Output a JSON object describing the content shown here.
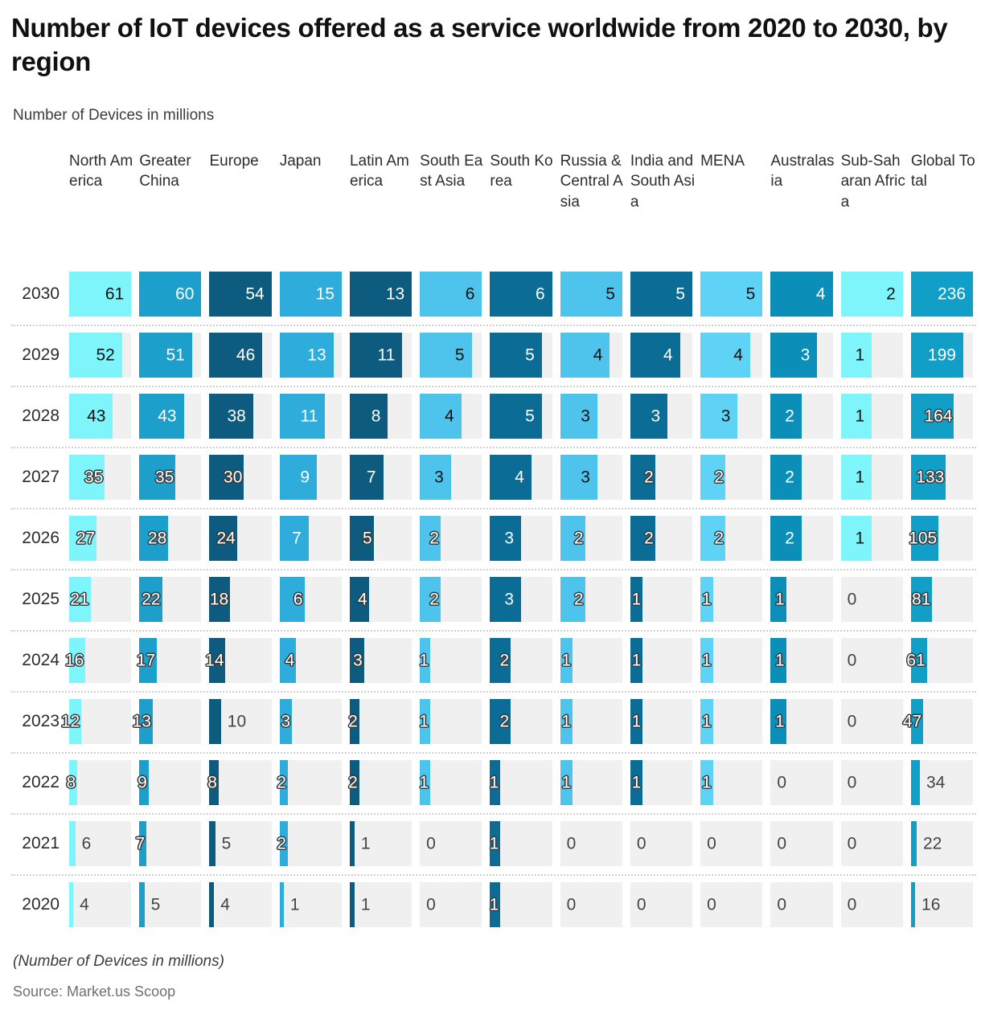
{
  "header": {
    "title": "Number of IoT devices offered as a service worldwide from 2020 to 2030, by region",
    "subtitle": "Number of Devices in millions"
  },
  "footer": {
    "note": "(Number of Devices in millions)",
    "source": "Source: Market.us Scoop"
  },
  "chart_data": {
    "type": "bar",
    "title": "Number of IoT devices offered as a service worldwide from 2020 to 2030, by region",
    "subtitle": "Number of Devices in millions",
    "xlabel": "",
    "ylabel": "Number of Devices in millions",
    "orientation": "horizontal",
    "layout": "small-multiples-grid",
    "grid": false,
    "legend": "none",
    "note": "Each column is an independent horizontal bar track scaled to that column's maximum (the 2030 row).",
    "categories": [
      "North America",
      "Greater China",
      "Europe",
      "Japan",
      "Latin America",
      "South East Asia",
      "South Korea",
      "Russia & Central Asia",
      "India and South Asia",
      "MENA",
      "Australasia",
      "Sub-Saharan Africa",
      "Global Total"
    ],
    "category_colors": [
      "#7df5fb",
      "#1d9fcb",
      "#0d5b7e",
      "#2eacdb",
      "#0d5b7e",
      "#4ec3ec",
      "#0b6d96",
      "#4ec3ec",
      "#0b6d96",
      "#5fd3f5",
      "#0b8fb8",
      "#7df5fb",
      "#129fc7"
    ],
    "rows": [
      "2030",
      "2029",
      "2028",
      "2027",
      "2026",
      "2025",
      "2024",
      "2023",
      "2022",
      "2021",
      "2020"
    ],
    "series": [
      {
        "name": "2030",
        "values": [
          61,
          60,
          54,
          15,
          13,
          6,
          6,
          5,
          5,
          5,
          4,
          2,
          236
        ]
      },
      {
        "name": "2029",
        "values": [
          52,
          51,
          46,
          13,
          11,
          5,
          5,
          4,
          4,
          4,
          3,
          1,
          199
        ]
      },
      {
        "name": "2028",
        "values": [
          43,
          43,
          38,
          11,
          8,
          4,
          5,
          3,
          3,
          3,
          2,
          1,
          164
        ]
      },
      {
        "name": "2027",
        "values": [
          35,
          35,
          30,
          9,
          7,
          3,
          4,
          3,
          2,
          2,
          2,
          1,
          133
        ]
      },
      {
        "name": "2026",
        "values": [
          27,
          28,
          24,
          7,
          5,
          2,
          3,
          2,
          2,
          2,
          2,
          1,
          105
        ]
      },
      {
        "name": "2025",
        "values": [
          21,
          22,
          18,
          6,
          4,
          2,
          3,
          2,
          1,
          1,
          1,
          0,
          81
        ]
      },
      {
        "name": "2024",
        "values": [
          16,
          17,
          14,
          4,
          3,
          1,
          2,
          1,
          1,
          1,
          1,
          0,
          61
        ]
      },
      {
        "name": "2023",
        "values": [
          12,
          13,
          10,
          3,
          2,
          1,
          2,
          1,
          1,
          1,
          1,
          0,
          47
        ]
      },
      {
        "name": "2022",
        "values": [
          8,
          9,
          8,
          2,
          2,
          1,
          1,
          1,
          1,
          1,
          0,
          0,
          34
        ]
      },
      {
        "name": "2021",
        "values": [
          6,
          7,
          5,
          2,
          1,
          0,
          1,
          0,
          0,
          0,
          0,
          0,
          22
        ]
      },
      {
        "name": "2020",
        "values": [
          4,
          5,
          4,
          1,
          1,
          0,
          1,
          0,
          0,
          0,
          0,
          0,
          16
        ]
      }
    ],
    "column_max": [
      61,
      60,
      54,
      15,
      13,
      6,
      6,
      5,
      5,
      5,
      4,
      2,
      236
    ]
  },
  "style": {
    "track_color": "#f0f0f0",
    "divider_color": "#cfcfcf",
    "text_color": "#2b2b2b"
  }
}
